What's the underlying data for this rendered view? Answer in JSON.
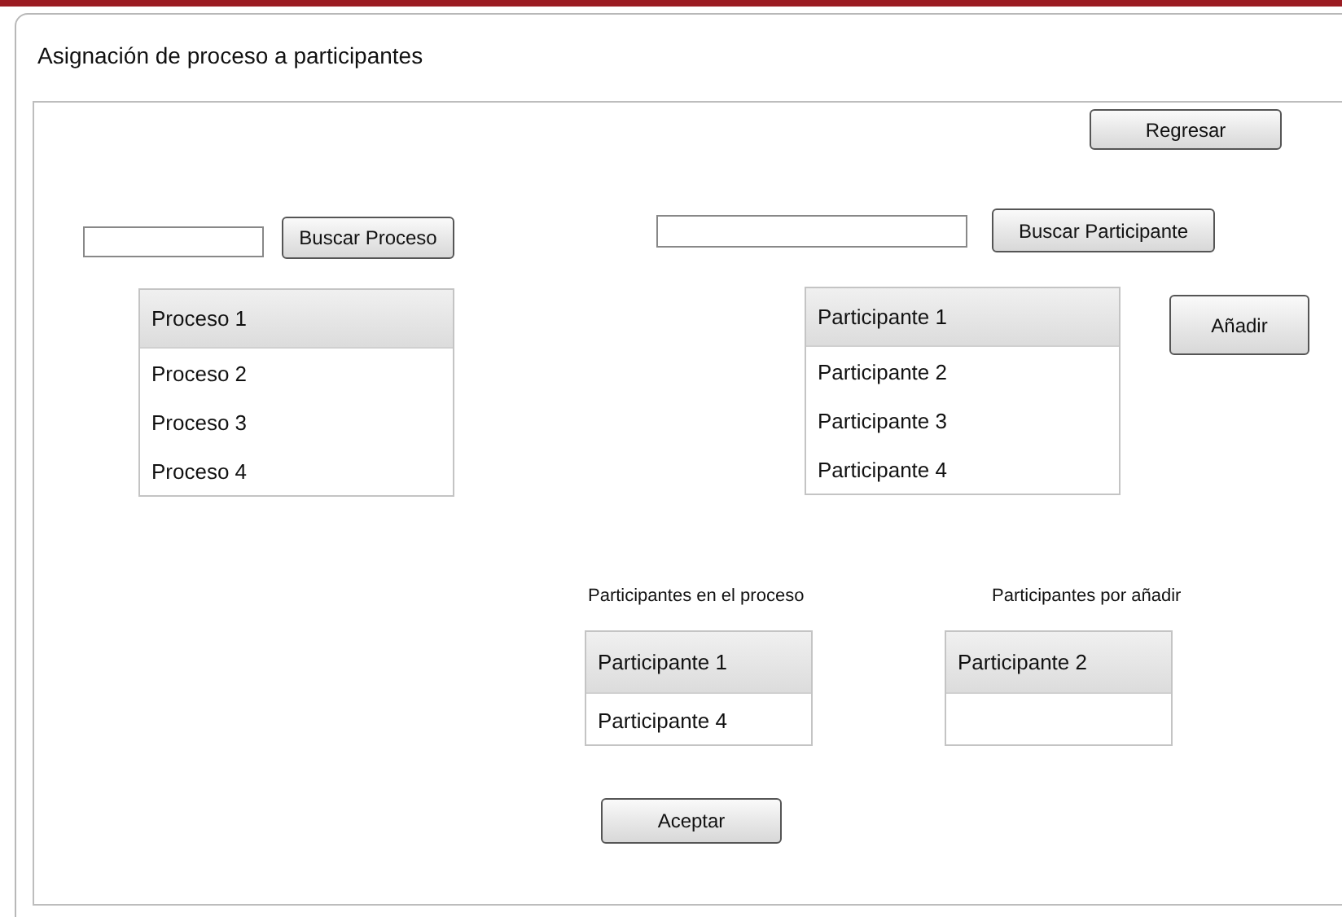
{
  "title": "Asignación de proceso a participantes",
  "back_button": "Regresar",
  "process_search": {
    "button": "Buscar Proceso"
  },
  "participant_search": {
    "button": "Buscar Participante"
  },
  "processes": [
    {
      "label": "Proceso 1",
      "selected": true
    },
    {
      "label": "Proceso 2",
      "selected": false
    },
    {
      "label": "Proceso 3",
      "selected": false
    },
    {
      "label": "Proceso 4",
      "selected": false
    }
  ],
  "participants": [
    {
      "label": "Participante 1",
      "selected": true
    },
    {
      "label": "Participante 2",
      "selected": false
    },
    {
      "label": "Participante 3",
      "selected": false
    },
    {
      "label": "Participante 4",
      "selected": false
    }
  ],
  "add_button": "Añadir",
  "in_process": {
    "heading": "Participantes en el proceso",
    "items": [
      {
        "label": "Participante 1",
        "selected": true
      },
      {
        "label": "Participante 4",
        "selected": false
      }
    ]
  },
  "to_add": {
    "heading": "Participantes por añadir",
    "items": [
      {
        "label": "Participante 2",
        "selected": true
      }
    ]
  },
  "accept_button": "Aceptar"
}
